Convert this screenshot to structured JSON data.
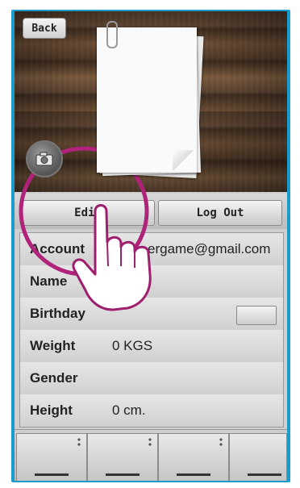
{
  "header": {
    "back_label": "Back"
  },
  "profile_actions": {
    "edit_label": "Edit",
    "logout_label": "Log Out"
  },
  "profile": {
    "rows": [
      {
        "label": "Account",
        "value": "ergame@gmail.com"
      },
      {
        "label": "Name",
        "value": ""
      },
      {
        "label": "Birthday",
        "value": ""
      },
      {
        "label": "Weight",
        "value": "0 KGS"
      },
      {
        "label": "Gender",
        "value": ""
      },
      {
        "label": "Height",
        "value": "0 cm."
      }
    ]
  },
  "icons": {
    "camera": "camera-icon",
    "paperclip": "paperclip-icon",
    "tap_gesture": "tap-hand-icon"
  },
  "colors": {
    "frame_border": "#1a9ccc",
    "highlight_circle": "#b0237a"
  }
}
